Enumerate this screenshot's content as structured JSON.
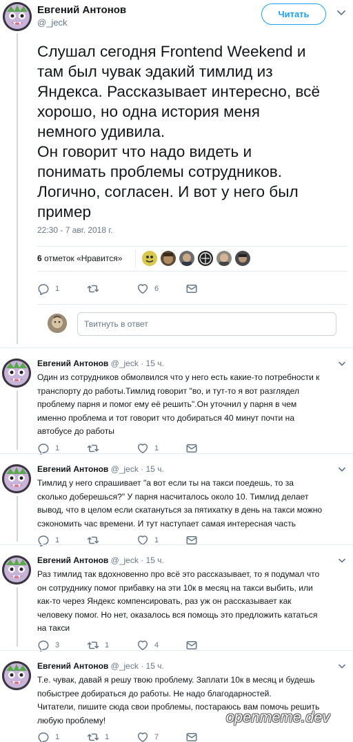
{
  "main_tweet": {
    "author_name": "Евгений Антонов",
    "author_handle": "@_jeck",
    "follow_label": "Читать",
    "text": "Слушал сегодня Frontend Weekend и\nтам был чувак эдакий тимлид из\nЯндекса. Рассказывает интересно, всё\nхорошо, но одна история меня\nнемного удивила.\nОн говорит что надо видеть и\nпонимать проблемы сотрудников.\nЛогично, согласен. И вот у него был\nпример",
    "timestamp": "22:30 - 7 авг. 2018 г.",
    "likes_count": "6",
    "likes_label": "отметок «Нравится»",
    "actions": {
      "replies": "1",
      "retweets": "",
      "likes": "6"
    },
    "reply_placeholder": "Твитнуть в ответ"
  },
  "replies": [
    {
      "author_name": "Евгений Антонов",
      "author_handle": "@_jeck",
      "time": "· 15 ч.",
      "text": "Один из сотрудников обмолвился что у него есть какие-то потребности к\nтранспорту до работы.Тимлид говорит \"во, и тут-то я вот разглядел\nпроблему парня и помог ему её решить\".Он уточнил у парня в чем\nименно проблема и тот говорит что добираться 40 минут почти на\nавтобусе до работы",
      "actions": {
        "replies": "1",
        "retweets": "",
        "likes": "1"
      }
    },
    {
      "author_name": "Евгений Антонов",
      "author_handle": "@_jeck",
      "time": "· 15 ч.",
      "text": "Тимлид у него спрашивает \"а вот если ты на такси поедешь, то за\nсколько доберешься?\" У парня насчиталось около 10. Тимлид делает\nвывод, что в целом если скатануться за пятихатку в день на такси можно\nсэкономить час времени. И тут наступает самая интересная часть",
      "actions": {
        "replies": "1",
        "retweets": "",
        "likes": "1"
      }
    },
    {
      "author_name": "Евгений Антонов",
      "author_handle": "@_jeck",
      "time": "· 15 ч.",
      "text": "Раз тимлид так вдохновенно про всё это рассказывает, то я подумал что\nон сотруднику помог прибавку на эти 10к в месяц на такси выбить, или\nкак-то через Яндекс компенсировать, раз уж он рассказывает как\nчеловеку помог. Но нет, оказалось вся помощь это предложить кататься\nна такси",
      "actions": {
        "replies": "3",
        "retweets": "1",
        "likes": "4"
      }
    },
    {
      "author_name": "Евгений Антонов",
      "author_handle": "@_jeck",
      "time": "· 15 ч.",
      "text": "Т.е. чувак, давай я решу твою проблему. Заплати 10к в месяц и будешь\nпобыстрее добираться до работы. Не надо благодарностей.\nЧитатели, пишите сюда свои проблемы, постараюсь вам помочь решить\nлюбую проблему!",
      "actions": {
        "replies": "1",
        "retweets": "1",
        "likes": "7"
      }
    }
  ],
  "watermark": "openmeme.dev",
  "colors": {
    "accent": "#1da1f2",
    "muted": "#657786",
    "text": "#14171a",
    "divider": "#e6ecf0"
  }
}
